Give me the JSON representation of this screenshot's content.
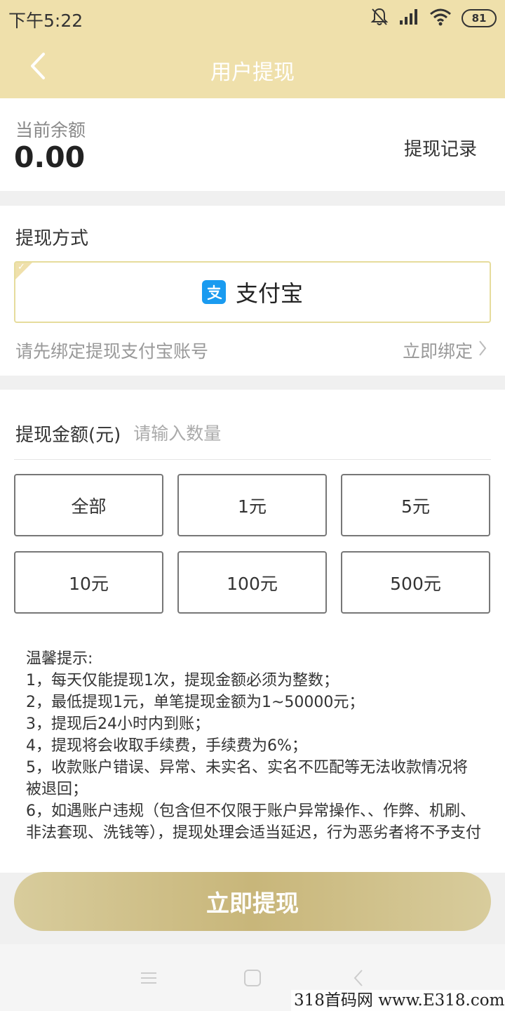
{
  "status_bar": {
    "time": "下午5:22",
    "battery": "81",
    "icons": [
      "bell-mute-icon",
      "signal-icon",
      "wifi-icon",
      "battery-icon"
    ]
  },
  "nav": {
    "title": "用户提现",
    "back_icon": "chevron-left-icon"
  },
  "balance": {
    "label": "当前余额",
    "value": "0.00",
    "history_link": "提现记录"
  },
  "method": {
    "title": "提现方式",
    "selected_option": "支付宝",
    "option_icon": "alipay-icon",
    "bind_hint": "请先绑定提现支付宝账号",
    "bind_link": "立即绑定"
  },
  "amount": {
    "label": "提现金额(元)",
    "placeholder": "请输入数量",
    "presets": [
      "全部",
      "1元",
      "5元",
      "10元",
      "100元",
      "500元"
    ]
  },
  "tips": {
    "title": "温馨提示:",
    "lines": [
      "1，每天仅能提现1次，提现金额必须为整数；",
      "2，最低提现1元，单笔提现金额为1~50000元；",
      "3，提现后24小时内到账；",
      "4，提现将会收取手续费，手续费为6%；",
      "5，收款账户错误、异常、未实名、实名不匹配等无法收款情况将被退回；",
      "6，如遇账户违规（包含但不仅限于账户异常操作、、作弊、机刷、非法套现、洗钱等），提现处理会适当延迟，行为恶劣者将不予支付"
    ]
  },
  "submit_label": "立即提现",
  "bottom_nav": [
    "menu-icon",
    "home-square-icon",
    "back-chevron-icon"
  ],
  "watermark": "318首码网  www.E318.com",
  "colors": {
    "header": "#efe0ab",
    "selected_border": "#e6dc9c",
    "button_gold": "#c8b67a",
    "alipay_blue": "#1a9bf0"
  }
}
